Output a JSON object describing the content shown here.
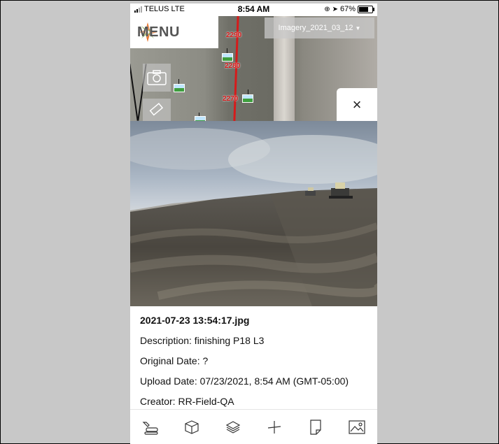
{
  "status": {
    "carrier": "TELUS",
    "network": "LTE",
    "time": "8:54 AM",
    "battery": "67%",
    "battery_level": 0.67
  },
  "map": {
    "menu_label": "MENU",
    "imagery_label": "Imagery_2021_03_12",
    "station_labels": [
      "2290",
      "2280",
      "2270"
    ],
    "close_label": "×"
  },
  "photo": {
    "filename": "2021-07-23 13:54:17.jpg",
    "description": "Description: finishing P18 L3",
    "original_date": "Original Date: ?",
    "upload_date": "Upload Date: 07/23/2021, 8:54 AM (GMT-05:00)",
    "creator": "Creator: RR-Field-QA"
  },
  "toolbar": {
    "icons": [
      "excavator-icon",
      "box-icon",
      "layers-icon",
      "measure-icon",
      "note-icon",
      "image-icon"
    ]
  },
  "colors": {
    "road": "#d61b1b",
    "menu_logo_orange": "#e8742a",
    "menu_logo_green": "#6a9e2a"
  }
}
